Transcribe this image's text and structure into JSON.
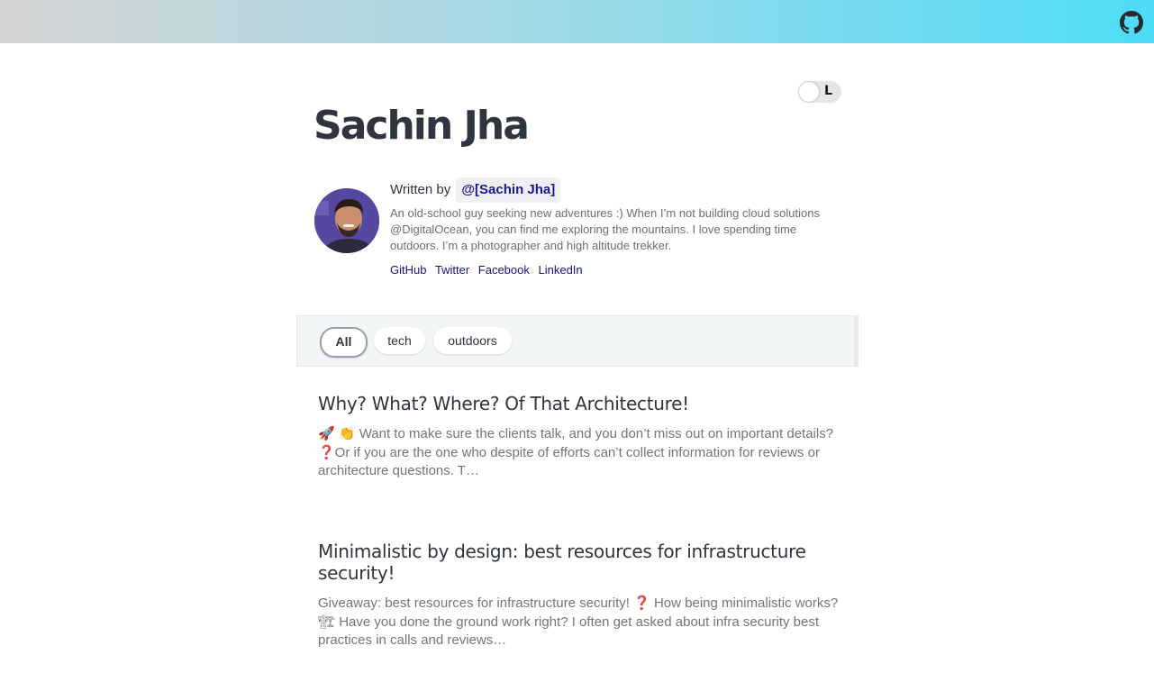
{
  "header": {
    "github_icon": "github-icon"
  },
  "theme_toggle": {
    "label": "L"
  },
  "site": {
    "title": "Sachin Jha"
  },
  "author": {
    "written_by": "Written by",
    "handle": "@[Sachin Jha]",
    "bio": "An old-school guy seeking new adventures :) When I’m not building cloud solutions @DigitalOcean, you can find me exploring the mountains. I love spending time outdoors. I’m a photographer and high altitude trekker.",
    "links": [
      "GitHub",
      "Twitter",
      "Facebook",
      "LinkedIn"
    ]
  },
  "filters": {
    "items": [
      "All",
      "tech",
      "outdoors"
    ],
    "active": "All"
  },
  "posts": [
    {
      "title": "Why? What? Where? Of That Architecture!",
      "excerpt": "🚀 👏 Want to make sure the clients talk, and you don’t miss out on important details? ❓Or if you are the one who despite of efforts can’t collect information for reviews or architecture questions. T…"
    },
    {
      "title": "Minimalistic by design: best resources for infrastructure security!",
      "excerpt": "Giveaway: best resources for infrastructure security! ❓ How being minimalistic works? 🏗 Have you done the ground work right? I often get asked about infra security best practices in calls and reviews…"
    }
  ],
  "colors": {
    "link": "#14148a",
    "title": "#2e353f",
    "muted": "#71767b",
    "gradient_start": "#d4d4d4",
    "gradient_end": "#4ddcf7"
  }
}
